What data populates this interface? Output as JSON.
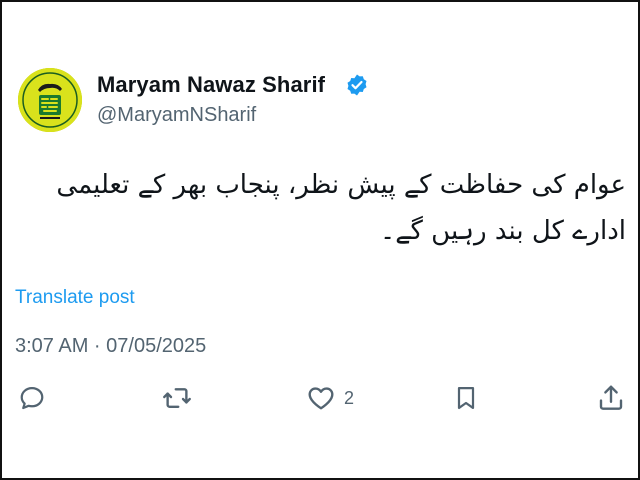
{
  "author": {
    "name": "Maryam Nawaz Sharif",
    "handle": "@MaryamNSharif",
    "verified": true,
    "avatar_icon": "party-logo-avatar"
  },
  "post": {
    "text": "عوام کی حفاظت کے پیش نظر، پنجاب بھر کے تعلیمی ادارے کل بند رہیں گے۔",
    "translate_label": "Translate post",
    "timestamp": "3:07 AM · 07/05/2025"
  },
  "actions": {
    "reply_icon": "reply-icon",
    "repost_icon": "repost-icon",
    "like_icon": "heart-icon",
    "like_count": "2",
    "bookmark_icon": "bookmark-icon",
    "share_icon": "share-icon"
  },
  "colors": {
    "link": "#1d9bf0",
    "muted": "#536471",
    "text": "#0f1419",
    "verified": "#1d9bf0",
    "avatar_bg": "#d9e21c"
  }
}
